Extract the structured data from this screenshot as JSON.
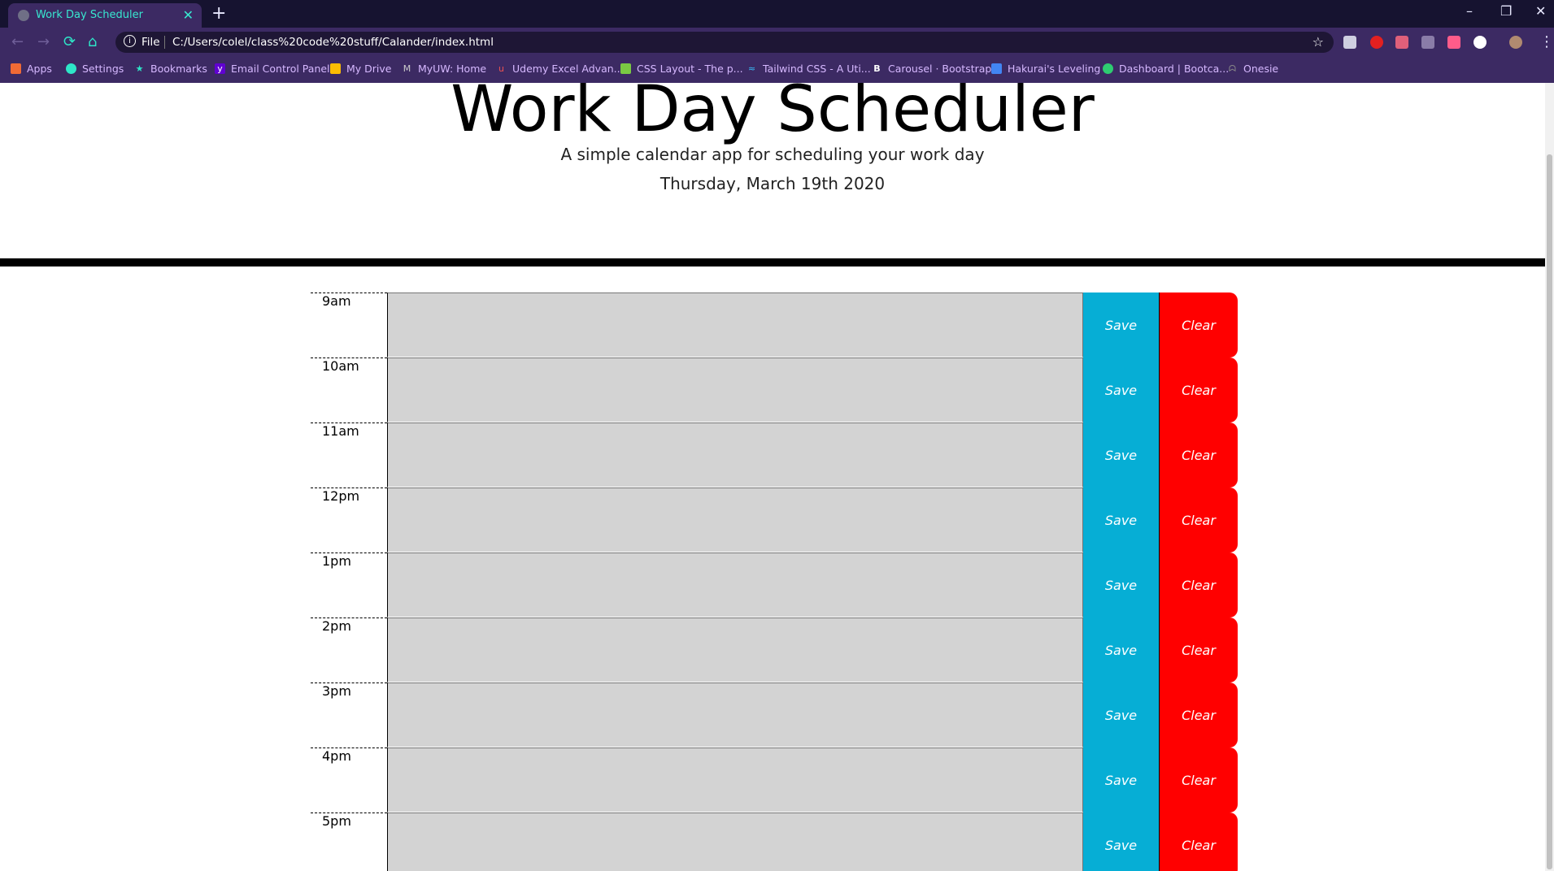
{
  "browser": {
    "tab_title": "Work Day Scheduler",
    "new_tab": "+",
    "url_scheme_label": "File",
    "url": "C:/Users/colel/class%20code%20stuff/Calander/index.html",
    "window_controls": [
      "–",
      "❐",
      "✕"
    ],
    "bookmarks": [
      {
        "label": "Apps",
        "icon": "apps-grid-icon",
        "color": "#f06a35"
      },
      {
        "label": "Settings",
        "icon": "gear-icon",
        "color": "#2ee6c8"
      },
      {
        "label": "Bookmarks",
        "icon": "star-icon",
        "color": "#2ee6c8"
      },
      {
        "label": "Email Control Panel",
        "icon": "yahoo-icon",
        "color": "#6001d2"
      },
      {
        "label": "My Drive",
        "icon": "drive-icon",
        "color": "#fbbc04"
      },
      {
        "label": "MyUW: Home",
        "icon": "myuw-icon",
        "color": "#cccccc"
      },
      {
        "label": "Udemy Excel Advan...",
        "icon": "udemy-icon",
        "color": "#ec5252"
      },
      {
        "label": "CSS Layout - The p...",
        "icon": "css-layout-icon",
        "color": "#7ac943"
      },
      {
        "label": "Tailwind CSS - A Uti...",
        "icon": "tailwind-icon",
        "color": "#38bdf8"
      },
      {
        "label": "Carousel · Bootstrap",
        "icon": "bootstrap-icon",
        "color": "#563d7c"
      },
      {
        "label": "Hakurai's Leveling",
        "icon": "doc-icon",
        "color": "#4285f4"
      },
      {
        "label": "Dashboard | Bootca...",
        "icon": "dashboard-icon",
        "color": "#2ecc71"
      },
      {
        "label": "Onesie",
        "icon": "onesie-icon",
        "color": "#888888"
      }
    ]
  },
  "header": {
    "title": "Work Day Scheduler",
    "subtitle": "A simple calendar app for scheduling your work day",
    "date": "Thursday, March 19th 2020"
  },
  "schedule": {
    "save_label": "Save",
    "clear_label": "Clear",
    "hours": [
      "9am",
      "10am",
      "11am",
      "12pm",
      "1pm",
      "2pm",
      "3pm",
      "4pm",
      "5pm"
    ]
  }
}
